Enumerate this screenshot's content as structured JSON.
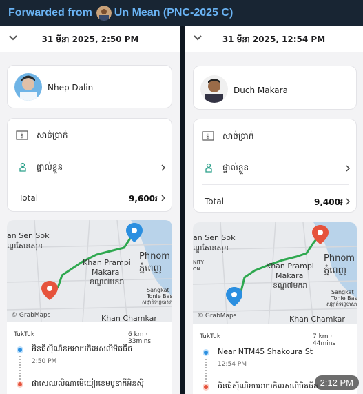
{
  "forward": {
    "label": "Forwarded from",
    "name": "Un Mean (PNC-2025 C)"
  },
  "left": {
    "date": "31 មីនា 2025, 2:50 PM",
    "driver": "Nhep Dalin",
    "payment_label": "សាច់ប្រាក់",
    "personal_label": "ផ្ទាល់ខ្លួន",
    "total_label": "Total",
    "total_value": "9,600៛",
    "map_labels": [
      "an Sen Sok",
      "ណ្ឌសែនសុខ",
      "Khan Prampi",
      "Makara",
      "ខណ្ឌ៧មករា",
      "Phnom",
      "ភ្នំពេញ",
      "Sangkat",
      "Tonle Bass",
      "សង្កាត់ទន្លេបាសាក់",
      "Khan Chamkar"
    ],
    "map_brand": "GrabMaps",
    "vehicle": "TukTuk",
    "distance_time": "6 km · 33mins",
    "pickup": "អិនធីស៊ីណិខមអាយកិអេសលីមិតធីត",
    "pickup_time": "2:50 PM",
    "dropoff": "ផាសេឈលិណាមើយៀរខេមបូឌាកីអិនស៊ី"
  },
  "right": {
    "date": "31 មីនា 2025, 12:54 PM",
    "driver": "Duch Makara",
    "payment_label": "សាច់ប្រាក់",
    "personal_label": "ផ្ទាល់ខ្លួន",
    "total_label": "Total",
    "total_value": "9,400៛",
    "map_labels": [
      "an Sen Sok",
      "ណ្ឌសែនសុខ",
      "Khan Prampi",
      "Makara",
      "ខណ្ឌ៧មករា",
      "Phnom",
      "ភ្នំពេញ",
      "Sangkat",
      "Tonle Bass",
      "សង្កាត់ទន្លេបាសាក់",
      "Khan Chamkar",
      "NITY",
      "ON"
    ],
    "map_brand": "GrabMaps",
    "vehicle": "TukTuk",
    "distance_time": "7 km · 44mins",
    "pickup": "Near NTM45 Shakoura St",
    "pickup_time": "12:54 PM",
    "dropoff": "អិនធីស៊ីណិខមអាយកិអេសលីមិតធីត"
  },
  "timestamp": "2:12 PM",
  "colors": {
    "pickup": "#2b8fe0",
    "dropoff": "#e6533c",
    "route": "#2ea84f",
    "header_text": "#6ab3f3"
  }
}
